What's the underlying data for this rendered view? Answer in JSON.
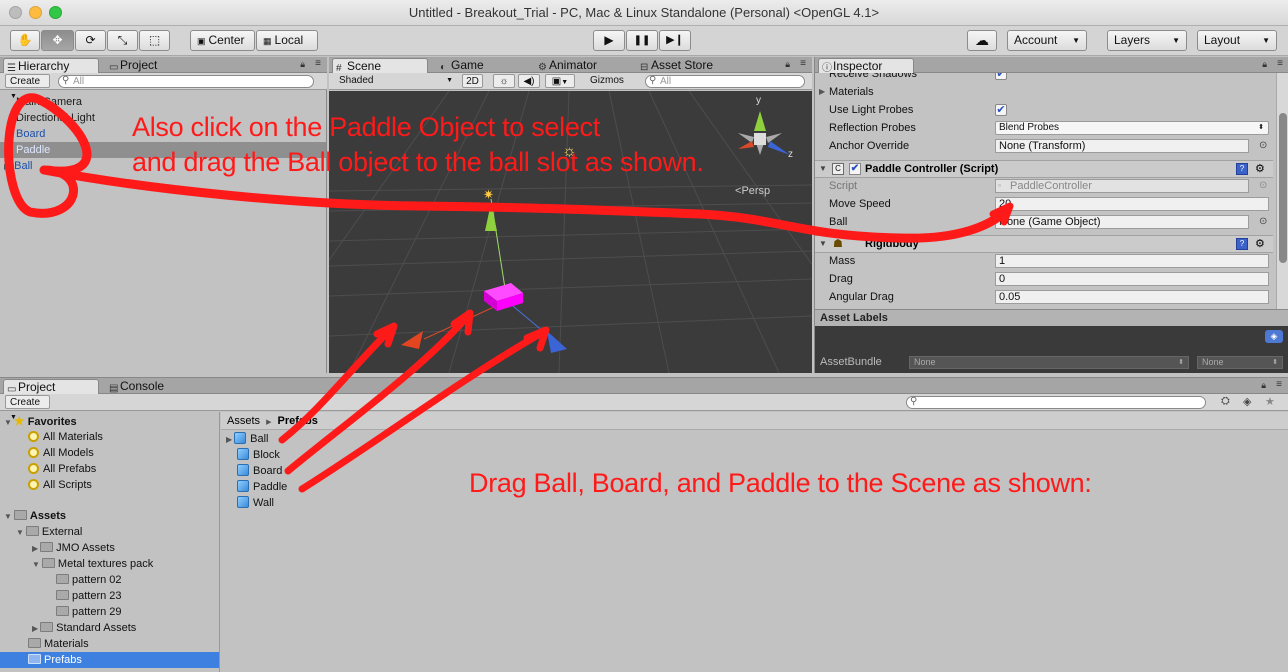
{
  "window": {
    "title": "Untitled - Breakout_Trial - PC, Mac & Linux Standalone (Personal) <OpenGL 4.1>"
  },
  "toolbar": {
    "tools": [
      {
        "icon": "hand-icon",
        "glyph": "✋"
      },
      {
        "icon": "move-icon",
        "glyph": "✥"
      },
      {
        "icon": "rotate-icon",
        "glyph": "⟳"
      },
      {
        "icon": "scale-icon",
        "glyph": "⤡"
      },
      {
        "icon": "rect-tool-icon",
        "glyph": "⬚"
      }
    ],
    "pivot": "Center",
    "space": "Local",
    "play_glyph": "▶",
    "pause_glyph": "❚❚",
    "step_glyph": "▶❙",
    "cloud_glyph": "☁",
    "account": "Account",
    "layers": "Layers",
    "layout": "Layout"
  },
  "hierarchy": {
    "tabs": [
      "Hierarchy",
      "Project"
    ],
    "create": "Create",
    "search_placeholder": "All",
    "items": [
      "Main Camera",
      "Directional Light",
      "Board",
      "Paddle",
      "Ball"
    ]
  },
  "scene": {
    "tabs": [
      "Scene",
      "Game",
      "Animator",
      "Asset Store"
    ],
    "shading": "Shaded",
    "mode_2d": "2D",
    "gizmos": "Gizmos",
    "search_placeholder": "All",
    "persp": "Persp",
    "gizmo_axes": [
      "y",
      "z"
    ]
  },
  "inspector": {
    "tab": "Inspector",
    "rows": [
      {
        "label": "Receive Shadows",
        "check": "✔"
      },
      {
        "label": "Materials"
      },
      {
        "label": "Use Light Probes",
        "check": "✔"
      },
      {
        "label": "Reflection Probes",
        "value": "Blend Probes"
      },
      {
        "label": "Anchor Override",
        "value": "None (Transform)"
      }
    ],
    "paddle_controller": {
      "title": "Paddle Controller (Script)",
      "rows": [
        {
          "label": "Script",
          "value": "PaddleController"
        },
        {
          "label": "Move Speed",
          "value": "20"
        },
        {
          "label": "Ball",
          "value": "None (Game Object)"
        }
      ]
    },
    "rigidbody": {
      "title": "Rigidbody",
      "rows": [
        {
          "label": "Mass",
          "value": "1"
        },
        {
          "label": "Drag",
          "value": "0"
        },
        {
          "label": "Angular Drag",
          "value": "0.05"
        }
      ]
    },
    "asset_labels": "Asset Labels",
    "asset_bundle": {
      "label": "AssetBundle",
      "value1": "None",
      "value2": "None"
    }
  },
  "project": {
    "tabs": [
      "Project",
      "Console"
    ],
    "create": "Create",
    "favorites": {
      "label": "Favorites",
      "items": [
        "All Materials",
        "All Models",
        "All Prefabs",
        "All Scripts"
      ]
    },
    "assets": {
      "label": "Assets",
      "tree": [
        {
          "label": "External",
          "indent": 1
        },
        {
          "label": "JMO Assets",
          "indent": 2
        },
        {
          "label": "Metal textures pack",
          "indent": 2
        },
        {
          "label": "pattern 02",
          "indent": 3
        },
        {
          "label": "pattern 23",
          "indent": 3
        },
        {
          "label": "pattern 29",
          "indent": 3
        },
        {
          "label": "Standard Assets",
          "indent": 2
        },
        {
          "label": "Materials",
          "indent": 1
        },
        {
          "label": "Prefabs",
          "indent": 1
        }
      ]
    },
    "breadcrumb": [
      "Assets",
      "Prefabs"
    ],
    "prefabs": [
      "Ball",
      "Block",
      "Board",
      "Paddle",
      "Wall"
    ]
  },
  "annotations": {
    "line1": "Also click on the Paddle Object to select",
    "line2": "and drag the Ball object to the ball slot as shown.",
    "line3": "Drag Ball, Board, and Paddle to the Scene as shown:"
  },
  "colors": {
    "annotation": "#ff1a1a",
    "selection": "#3d80df",
    "scene_bg": "#3b3b3b",
    "paddle": "#ff00ff"
  }
}
